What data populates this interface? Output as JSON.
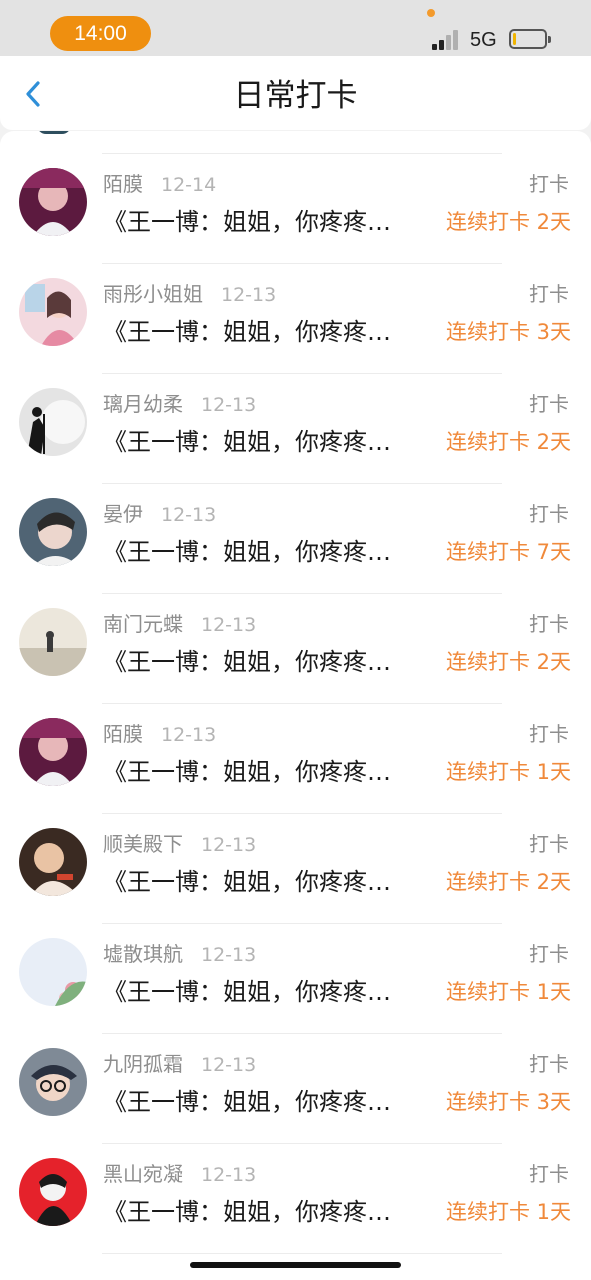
{
  "status_bar": {
    "time": "14:00",
    "network": "5G",
    "battery_level": 0.1,
    "colors": {
      "time_pill": "#ef8f0f",
      "battery_fill": "#f0b400"
    }
  },
  "header": {
    "title": "日常打卡",
    "back_icon": "chevron-left-icon",
    "accent": "#2f8fd8"
  },
  "checkins": [
    {
      "name": "陌膜",
      "date": "12-14",
      "type": "打卡",
      "message": "《王一博：姐姐，你疼疼…",
      "streak": "连续打卡 2天"
    },
    {
      "name": "雨彤小姐姐",
      "date": "12-13",
      "type": "打卡",
      "message": "《王一博：姐姐，你疼疼…",
      "streak": "连续打卡 3天"
    },
    {
      "name": "璃月幼柔",
      "date": "12-13",
      "type": "打卡",
      "message": "《王一博：姐姐，你疼疼…",
      "streak": "连续打卡 2天"
    },
    {
      "name": "晏伊",
      "date": "12-13",
      "type": "打卡",
      "message": "《王一博：姐姐，你疼疼…",
      "streak": "连续打卡 7天"
    },
    {
      "name": "南门元蝶",
      "date": "12-13",
      "type": "打卡",
      "message": "《王一博：姐姐，你疼疼…",
      "streak": "连续打卡 2天"
    },
    {
      "name": "陌膜",
      "date": "12-13",
      "type": "打卡",
      "message": "《王一博：姐姐，你疼疼…",
      "streak": "连续打卡 1天"
    },
    {
      "name": "顺美殿下",
      "date": "12-13",
      "type": "打卡",
      "message": "《王一博：姐姐，你疼疼…",
      "streak": "连续打卡 2天"
    },
    {
      "name": "墟散琪航",
      "date": "12-13",
      "type": "打卡",
      "message": "《王一博：姐姐，你疼疼…",
      "streak": "连续打卡 1天"
    },
    {
      "name": "九阴孤霜",
      "date": "12-13",
      "type": "打卡",
      "message": "《王一博：姐姐，你疼疼…",
      "streak": "连续打卡 3天"
    },
    {
      "name": "黑山宛凝",
      "date": "12-13",
      "type": "打卡",
      "message": "《王一博：姐姐，你疼疼…",
      "streak": "连续打卡 1天"
    }
  ],
  "colors": {
    "streak": "#f0893a",
    "name": "#8e8e8e",
    "date": "#b4b4b4"
  }
}
